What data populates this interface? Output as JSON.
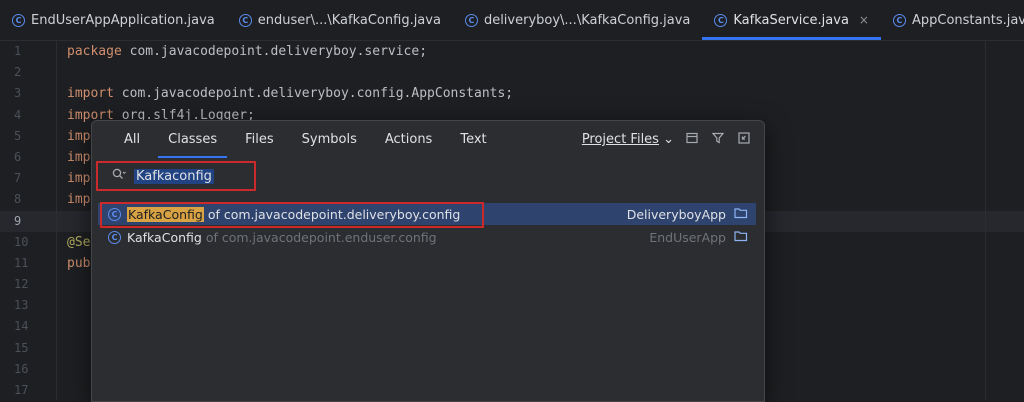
{
  "tabs": [
    {
      "label": "EndUserAppApplication.java",
      "active": false
    },
    {
      "label": "enduser\\...\\KafkaConfig.java",
      "active": false
    },
    {
      "label": "deliveryboy\\...\\KafkaConfig.java",
      "active": false
    },
    {
      "label": "KafkaService.java",
      "active": true,
      "close": "×"
    },
    {
      "label": "AppConstants.java",
      "active": false
    }
  ],
  "editor": {
    "line_numbers": [
      "1",
      "2",
      "3",
      "4",
      "5",
      "6",
      "7",
      "8",
      "9",
      "10",
      "11",
      "12",
      "13",
      "14",
      "15",
      "16",
      "17"
    ],
    "current_line": "9",
    "lines": [
      {
        "kw": "package",
        "rest": " com.javacodepoint.deliveryboy.service;"
      },
      {
        "kw": "",
        "rest": ""
      },
      {
        "kw": "import",
        "rest": " com.javacodepoint.deliveryboy.config.AppConstants;"
      },
      {
        "kw": "import",
        "rest": " org.slf4j.Logger;"
      },
      {
        "kw": "imp",
        "rest": ""
      },
      {
        "kw": "imp",
        "rest": ""
      },
      {
        "kw": "imp",
        "rest": ""
      },
      {
        "kw": "imp",
        "rest": ""
      },
      {
        "kw": "",
        "rest": ""
      },
      {
        "ann": "@Se",
        "rest": ""
      },
      {
        "kw": "pub",
        "rest": ""
      }
    ]
  },
  "popup": {
    "tabs": [
      "All",
      "Classes",
      "Files",
      "Symbols",
      "Actions",
      "Text"
    ],
    "active_tab": "Classes",
    "project_files_label": "Project Files",
    "search_value": "Kafkaconfig",
    "results": [
      {
        "name": "KafkaConfig",
        "of": "of com.javacodepoint.deliveryboy.config",
        "module": "DeliveryboyApp",
        "selected": true
      },
      {
        "name": "KafkaConfig",
        "of": "of com.javacodepoint.enduser.config",
        "module": "EndUserApp",
        "selected": false
      }
    ]
  },
  "colors": {
    "accent": "#3574f0",
    "highlight_box": "#cc2a2a",
    "match_highlight": "#d9a343"
  }
}
